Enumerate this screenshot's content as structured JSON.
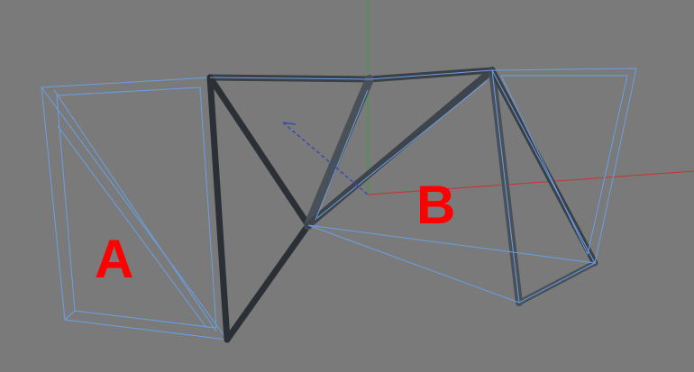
{
  "viewport": {
    "labels": {
      "a": "A",
      "b": "B"
    }
  },
  "colors": {
    "background": "#7a7a7a",
    "label": "#ff0000",
    "wireframe": "#6aa0e6",
    "edge_dark": "#3b4046",
    "edge_face": "#5a6068",
    "axis_x": "#c83232",
    "axis_y": "#2fa82f",
    "gizmo": "#3a4ab0"
  }
}
